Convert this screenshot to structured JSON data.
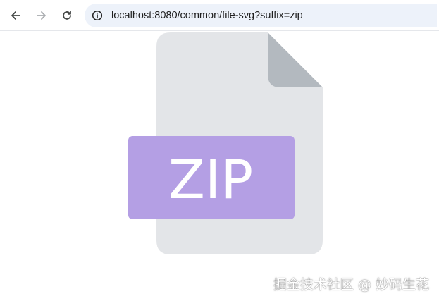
{
  "browser": {
    "url": "localhost:8080/common/file-svg?suffix=zip",
    "back_icon": "arrow-left-icon",
    "forward_icon": "arrow-right-icon",
    "reload_icon": "reload-icon",
    "site_info_icon": "info-circle-icon"
  },
  "file_icon": {
    "extension": "ZIP",
    "colors": {
      "page": "#e3e5e8",
      "fold": "#b3b9bf",
      "label": "#b49fe4",
      "label_text": "#ffffff"
    }
  },
  "watermark": {
    "text": "掘金技术社区 @ 妙码生花"
  }
}
